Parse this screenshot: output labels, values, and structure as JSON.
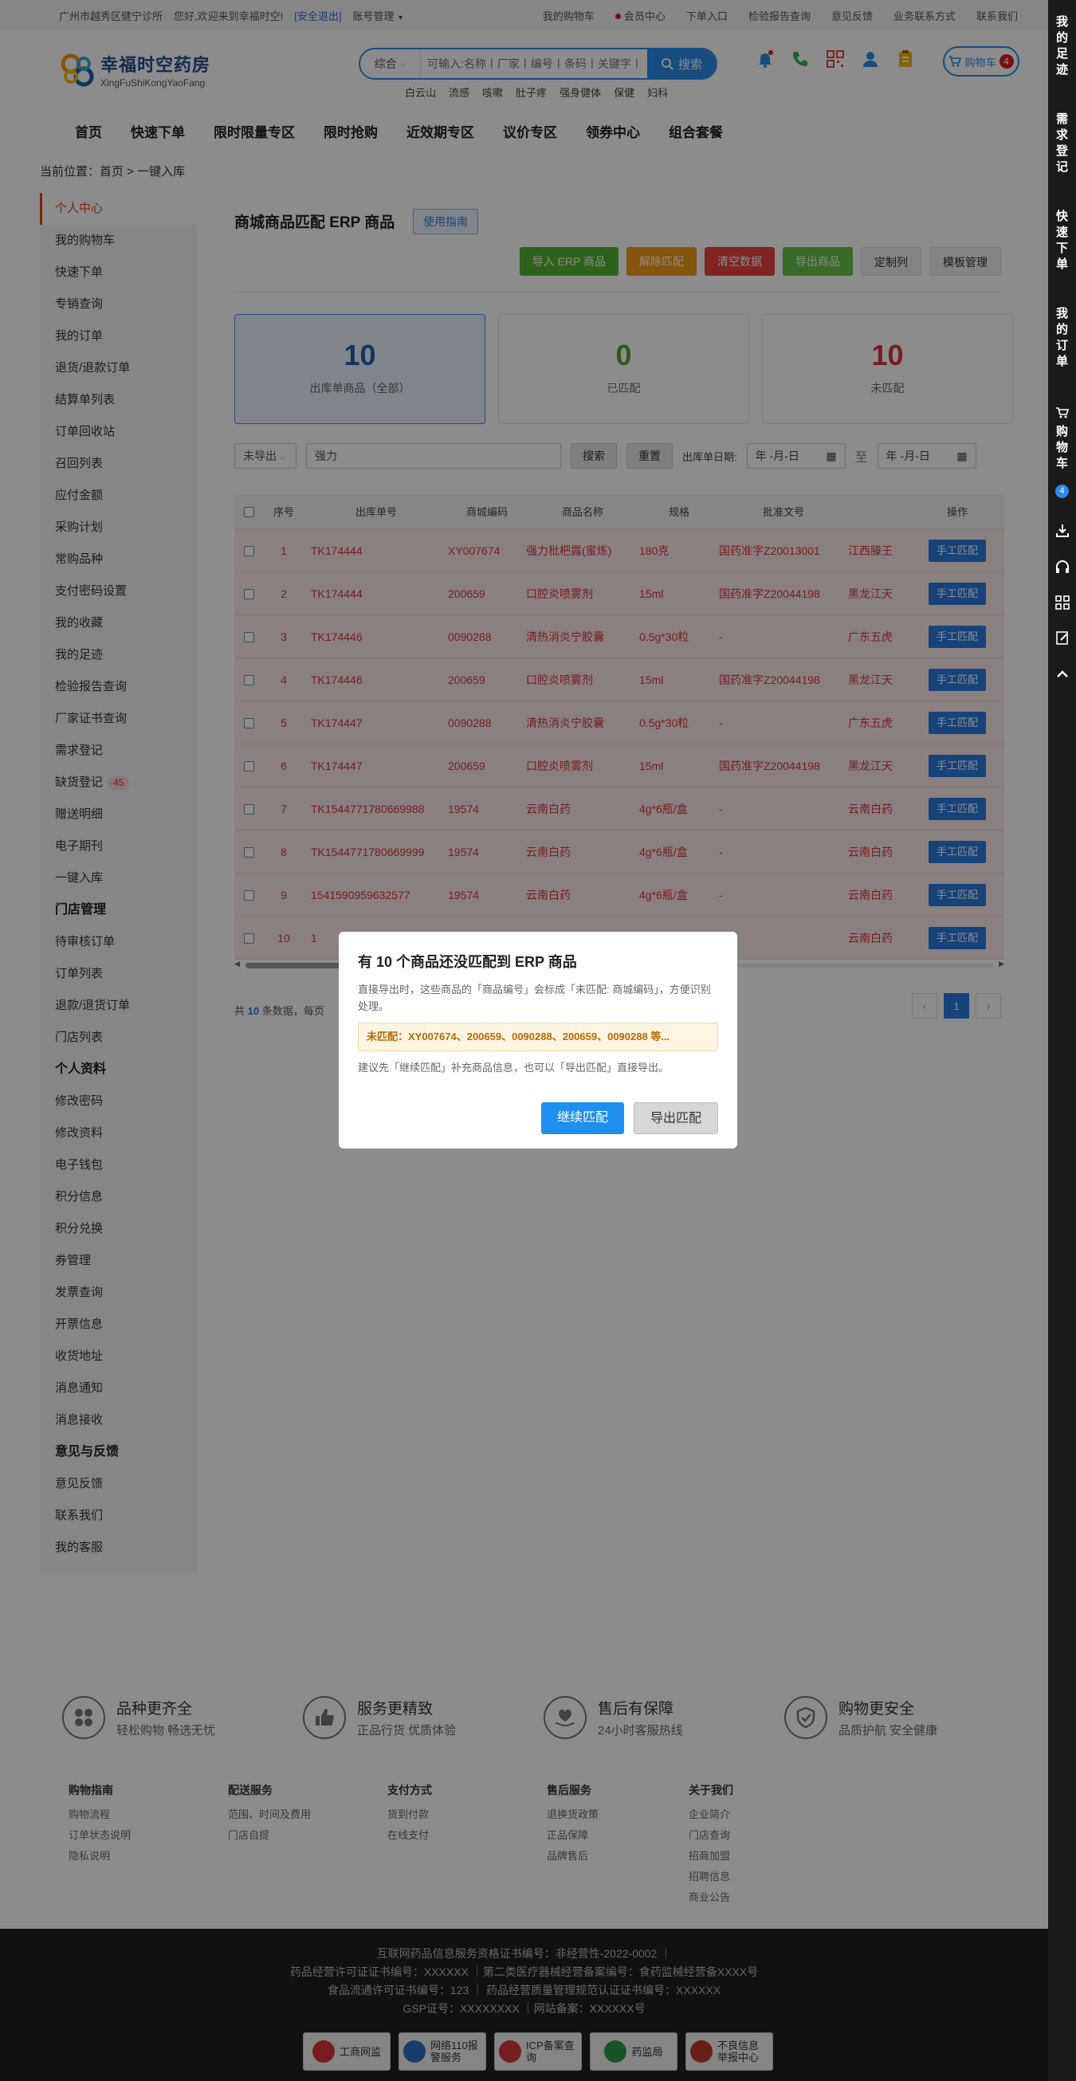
{
  "topbar": {
    "location": "广州市越秀区健宁诊所",
    "greeting": "您好,欢迎来到幸福时空!",
    "logout": "[安全退出]",
    "account": "账号管理",
    "links": [
      "我的购物车",
      "会员中心",
      "下单入口",
      "检验报告查询",
      "意见反馈",
      "业务联系方式",
      "联系我们"
    ]
  },
  "header": {
    "logo_cn": "幸福时空药房",
    "logo_en": "XingFuShiKongYaoFang",
    "search_type": "综合",
    "search_placeholder": "可输入:名称丨厂家丨编号丨条码丨关键字丨通用名",
    "search_button": "搜索",
    "hotwords": [
      "白云山",
      "流感",
      "咳嗽",
      "肚子疼",
      "强身健体",
      "保健",
      "妇科"
    ],
    "icons": [
      "bell-icon",
      "phone-icon",
      "qrcode-icon",
      "user-icon",
      "clipboard-icon"
    ],
    "cart_label": "购物车",
    "cart_count": "4"
  },
  "nav": [
    "首页",
    "快速下单",
    "限时限量专区",
    "限时抢购",
    "近效期专区",
    "议价专区",
    "领券中心",
    "组合套餐"
  ],
  "breadcrumb": "当前位置：首页 > 一键入库",
  "sidebar": [
    {
      "label": "个人中心",
      "type": "active"
    },
    {
      "label": "我的购物车"
    },
    {
      "label": "快速下单"
    },
    {
      "label": "专销查询"
    },
    {
      "label": "我的订单"
    },
    {
      "label": "退货/退款订单"
    },
    {
      "label": "结算单列表"
    },
    {
      "label": "订单回收站"
    },
    {
      "label": "召回列表"
    },
    {
      "label": "应付金额"
    },
    {
      "label": "采购计划"
    },
    {
      "label": "常购品种"
    },
    {
      "label": "支付密码设置"
    },
    {
      "label": "我的收藏"
    },
    {
      "label": "我的足迹"
    },
    {
      "label": "检验报告查询"
    },
    {
      "label": "厂家证书查询"
    },
    {
      "label": "需求登记"
    },
    {
      "label": "缺货登记",
      "count": "45"
    },
    {
      "label": "赠送明细"
    },
    {
      "label": "电子期刊"
    },
    {
      "label": "一键入库"
    },
    {
      "label": "门店管理",
      "type": "header"
    },
    {
      "label": "待审核订单"
    },
    {
      "label": "订单列表"
    },
    {
      "label": "退款/退货订单"
    },
    {
      "label": "门店列表"
    },
    {
      "label": "个人资料",
      "type": "header"
    },
    {
      "label": "修改密码"
    },
    {
      "label": "修改资料"
    },
    {
      "label": "电子钱包"
    },
    {
      "label": "积分信息"
    },
    {
      "label": "积分兑换"
    },
    {
      "label": "券管理"
    },
    {
      "label": "发票查询"
    },
    {
      "label": "开票信息"
    },
    {
      "label": "收货地址"
    },
    {
      "label": "消息通知"
    },
    {
      "label": "消息接收"
    },
    {
      "label": "意见与反馈",
      "type": "header"
    },
    {
      "label": "意见反馈"
    },
    {
      "label": "联系我们"
    },
    {
      "label": "我的客服"
    }
  ],
  "main": {
    "title": "商城商品匹配 ERP 商品",
    "guide": "使用指南",
    "actions": [
      {
        "label": "导入 ERP 商品",
        "color": "green"
      },
      {
        "label": "解除匹配",
        "color": "orange"
      },
      {
        "label": "清空数据",
        "color": "red"
      },
      {
        "label": "导出商品",
        "color": "lgreen"
      },
      {
        "label": "定制列",
        "color": "gray"
      },
      {
        "label": "模板管理",
        "color": "gray"
      }
    ],
    "cards": [
      {
        "value": "10",
        "label": "出库单商品（全部）",
        "color": "#1f5fae"
      },
      {
        "value": "0",
        "label": "已匹配",
        "color": "#53a22a"
      },
      {
        "value": "10",
        "label": "未匹配",
        "color": "#d9353a"
      }
    ],
    "filter": {
      "status": "未导出",
      "keyword": "强力",
      "search": "搜索",
      "reset": "重置",
      "date_label": "出库单日期:",
      "date_from": "年 -月-日",
      "sep": "至",
      "date_to": "年 -月-日"
    },
    "columns": [
      "",
      "序号",
      "出库单号",
      "商城编码",
      "商品名称",
      "规格",
      "批准文号",
      "",
      "操作"
    ],
    "rows": [
      [
        "1",
        "TK174444",
        "XY007674",
        "强力枇杷露(蜜炼)",
        "180克",
        "国药准字Z20013001",
        "江西滕王"
      ],
      [
        "2",
        "TK174444",
        "200659",
        "口腔炎喷雾剂",
        "15ml",
        "国药准字Z20044198",
        "黑龙江天"
      ],
      [
        "3",
        "TK174446",
        "0090288",
        "清热消炎宁胶囊",
        "0.5g*30粒",
        "-",
        "广东五虎"
      ],
      [
        "4",
        "TK174446",
        "200659",
        "口腔炎喷雾剂",
        "15ml",
        "国药准字Z20044198",
        "黑龙江天"
      ],
      [
        "5",
        "TK174447",
        "0090288",
        "清热消炎宁胶囊",
        "0.5g*30粒",
        "-",
        "广东五虎"
      ],
      [
        "6",
        "TK174447",
        "200659",
        "口腔炎喷雾剂",
        "15ml",
        "国药准字Z20044198",
        "黑龙江天"
      ],
      [
        "7",
        "TK1544771780669988",
        "19574",
        "云南白药",
        "4g*6瓶/盒",
        "-",
        "云南白药"
      ],
      [
        "8",
        "TK1544771780669999",
        "19574",
        "云南白药",
        "4g*6瓶/盒",
        "-",
        "云南白药"
      ],
      [
        "9",
        "1541590959632577",
        "19574",
        "云南白药",
        "4g*6瓶/盒",
        "-",
        "云南白药"
      ],
      [
        "10",
        "1",
        "",
        "",
        "",
        "-",
        "云南白药"
      ]
    ],
    "row_button": "手工匹配",
    "pager_prefix": "共",
    "pager_total": "10",
    "pager_suffix": "条数据，每页",
    "pages": [
      "‹",
      "1",
      "›"
    ]
  },
  "dialog": {
    "title": "有 10 个商品还没匹配到 ERP 商品",
    "desc": "直接导出时，这些商品的「商品编号」会标成「未匹配: 商城编码」，方便识别处理。",
    "warning": "未匹配：XY007674、200659、0090288、200659、0090288 等...",
    "note": "建议先「继续匹配」补充商品信息，也可以「导出匹配」直接导出。",
    "ok": "继续匹配",
    "cancel": "导出匹配"
  },
  "dock": {
    "items": [
      "我的足迹",
      "需求登记",
      "快速下单",
      "我的订单",
      "购物车"
    ],
    "cart_count": "4",
    "icons": [
      "download-icon",
      "headset-icon",
      "grid-icon",
      "edit-icon",
      "arrow-up-icon"
    ]
  },
  "features": [
    {
      "title": "品种更齐全",
      "sub": "轻松购物 畅选无忧",
      "icon": "grid-icon"
    },
    {
      "title": "服务更精致",
      "sub": "正品行货 优质体验",
      "icon": "thumbs-up-icon"
    },
    {
      "title": "售后有保障",
      "sub": "24小时客服热线",
      "icon": "heart-hand-icon"
    },
    {
      "title": "购物更安全",
      "sub": "品质护航 安全健康",
      "icon": "shield-check-icon"
    }
  ],
  "footer_links": [
    {
      "title": "购物指南",
      "items": [
        "购物流程",
        "订单状态说明",
        "隐私说明"
      ]
    },
    {
      "title": "配送服务",
      "items": [
        "范围、时间及费用",
        "门店自提"
      ]
    },
    {
      "title": "支付方式",
      "items": [
        "货到付款",
        "在线支付"
      ]
    },
    {
      "title": "售后服务",
      "items": [
        "退换货政策",
        "正品保障",
        "品牌售后"
      ]
    },
    {
      "title": "关于我们",
      "items": [
        "企业简介",
        "门店查询",
        "招商加盟",
        "招聘信息",
        "商业公告"
      ]
    }
  ],
  "copyright": [
    "互联网药品信息服务资格证书编号：非经营性-2022-0002 ｜",
    "药品经营许可证证书编号：XXXXXX ｜第二类医疗器械经营备案编号：食药监械经营备XXXX号",
    "食品流通许可证书编号：123 ｜ 药品经营质量管理规范认证证书编号：XXXXXX",
    "GSP证号：XXXXXXXX ｜网站备案：XXXXXX号"
  ],
  "badges": [
    {
      "label": "工商网监",
      "color": "#d9353a"
    },
    {
      "label": "网络110报警服务",
      "color": "#2b6fc7"
    },
    {
      "label": "ICP备案查询",
      "color": "#d9353a"
    },
    {
      "label": "药监局",
      "color": "#2e9a4a"
    },
    {
      "label": "不良信息举报中心",
      "color": "#c0392b"
    }
  ]
}
